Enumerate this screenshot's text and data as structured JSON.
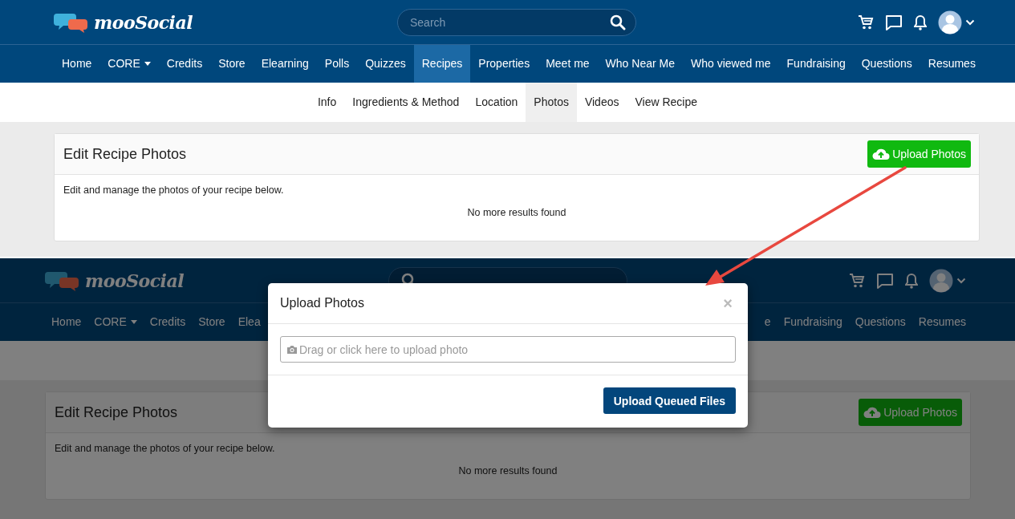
{
  "screens": [
    {
      "dimmed": false,
      "brand": "mooSocial",
      "search": {
        "placeholder": "Search"
      },
      "nav": [
        {
          "label": "Home",
          "selected": false,
          "dropdown": false
        },
        {
          "label": "CORE",
          "selected": false,
          "dropdown": true
        },
        {
          "label": "Credits",
          "selected": false,
          "dropdown": false
        },
        {
          "label": "Store",
          "selected": false,
          "dropdown": false
        },
        {
          "label": "Elearning",
          "selected": false,
          "dropdown": false
        },
        {
          "label": "Polls",
          "selected": false,
          "dropdown": false
        },
        {
          "label": "Quizzes",
          "selected": false,
          "dropdown": false
        },
        {
          "label": "Recipes",
          "selected": true,
          "dropdown": false
        },
        {
          "label": "Properties",
          "selected": false,
          "dropdown": false
        },
        {
          "label": "Meet me",
          "selected": false,
          "dropdown": false
        },
        {
          "label": "Who Near Me",
          "selected": false,
          "dropdown": false
        },
        {
          "label": "Who viewed me",
          "selected": false,
          "dropdown": false
        },
        {
          "label": "Fundraising",
          "selected": false,
          "dropdown": false
        },
        {
          "label": "Questions",
          "selected": false,
          "dropdown": false
        },
        {
          "label": "Resumes",
          "selected": false,
          "dropdown": false
        }
      ],
      "subnav": [
        {
          "label": "Info",
          "selected": false
        },
        {
          "label": "Ingredients & Method",
          "selected": false
        },
        {
          "label": "Location",
          "selected": false
        },
        {
          "label": "Photos",
          "selected": true
        },
        {
          "label": "Videos",
          "selected": false
        },
        {
          "label": "View Recipe",
          "selected": false
        }
      ],
      "card": {
        "title": "Edit Recipe Photos",
        "button": "Upload Photos",
        "description": "Edit and manage the photos of your recipe below.",
        "empty_message": "No more results found"
      }
    },
    {
      "dimmed": true,
      "brand": "mooSocial",
      "nav": [
        {
          "label": "Home",
          "selected": false,
          "dropdown": false
        },
        {
          "label": "CORE",
          "selected": false,
          "dropdown": true
        },
        {
          "label": "Credits",
          "selected": false,
          "dropdown": false
        },
        {
          "label": "Store",
          "selected": false,
          "dropdown": false
        },
        {
          "label": "Elea",
          "selected": false,
          "dropdown": false
        }
      ],
      "nav_right": [
        {
          "label": "e",
          "selected": false,
          "dropdown": false
        },
        {
          "label": "Fundraising",
          "selected": false,
          "dropdown": false
        },
        {
          "label": "Questions",
          "selected": false,
          "dropdown": false
        },
        {
          "label": "Resumes",
          "selected": false,
          "dropdown": false
        }
      ],
      "card": {
        "title": "Edit Recipe Photos",
        "button": "Upload Photos",
        "description": "Edit and manage the photos of your recipe below.",
        "empty_message": "No more results found"
      },
      "modal": {
        "title": "Upload Photos",
        "close": "×",
        "dropzone": {
          "placeholder": "Drag or click here to upload photo"
        },
        "button": "Upload Queued Files"
      }
    }
  ],
  "annotation": {
    "kind": "arrow",
    "color": "#e8483f"
  }
}
